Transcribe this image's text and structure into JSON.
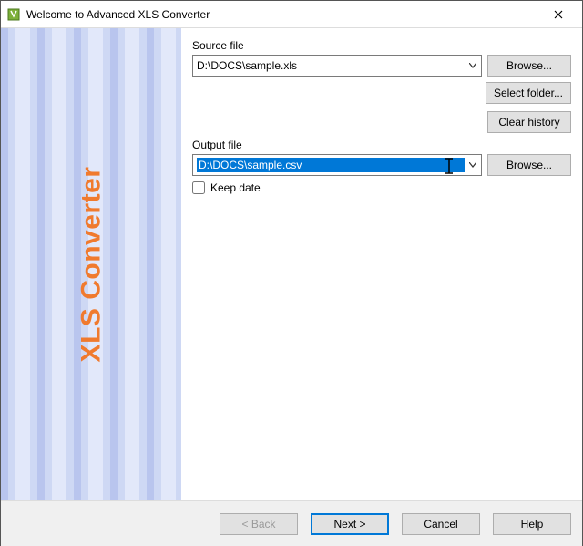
{
  "window": {
    "title": "Welcome to Advanced XLS Converter"
  },
  "sidebar": {
    "brand": "XLS Converter"
  },
  "source": {
    "label": "Source file",
    "value": "D:\\DOCS\\sample.xls",
    "browse": "Browse...",
    "select_folder": "Select folder...",
    "clear_history": "Clear history"
  },
  "output": {
    "label": "Output file",
    "value": "D:\\DOCS\\sample.csv",
    "browse": "Browse..."
  },
  "options": {
    "keep_date": "Keep date"
  },
  "footer": {
    "back": "< Back",
    "next": "Next >",
    "cancel": "Cancel",
    "help": "Help"
  }
}
